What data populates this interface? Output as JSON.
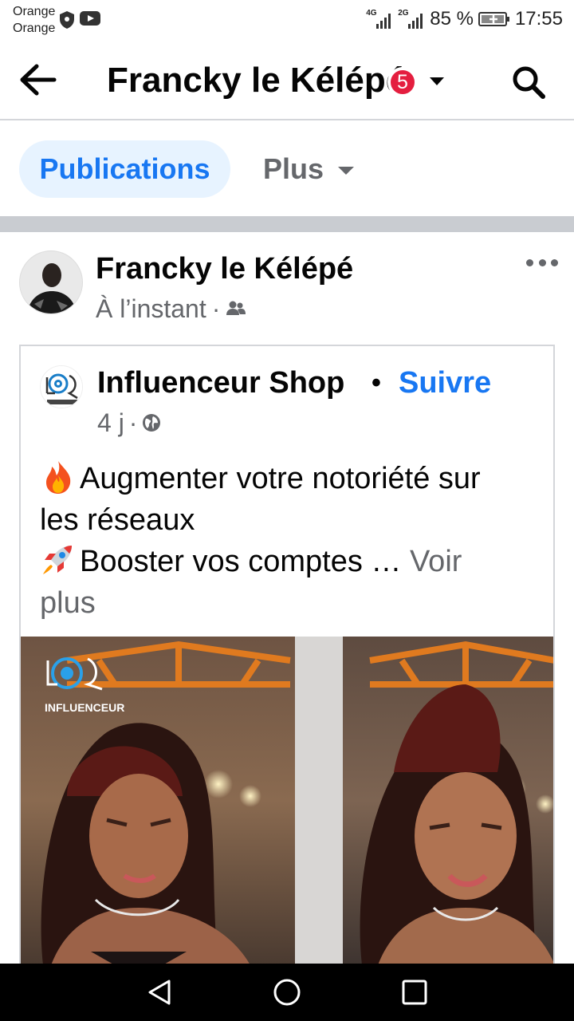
{
  "status_bar": {
    "carrier_line1": "Orange",
    "carrier_line2": "Orange",
    "signal1_tag": "4G",
    "signal2_tag": "2G",
    "battery": "85 %",
    "time": "17:55"
  },
  "header": {
    "title": "Francky le Kélépé",
    "badge_count": "5"
  },
  "tabs": {
    "publications": "Publications",
    "plus": "Plus"
  },
  "post": {
    "author": "Francky le Kélépé",
    "time": "À l’instant",
    "shared": {
      "page_name": "Influenceur Shop",
      "separator": "•",
      "follow_label": "Suivre",
      "time": "4 j",
      "text_line1": "Augmenter votre notoriété sur",
      "text_line2": "les réseaux",
      "text_line3": "Booster vos comptes … ",
      "see_more_1": "Voir",
      "see_more_2": "plus",
      "media_watermark": "INFLUENCEUR"
    }
  },
  "colors": {
    "accent": "#1877f2",
    "badge": "#e41e3f",
    "muted": "#65676b",
    "separator": "#c9ccd1"
  },
  "icons": {
    "back": "arrow-left-icon",
    "search": "search-icon",
    "caret": "chevron-down-icon",
    "more": "more-horizontal-icon",
    "audience_friends": "friends-icon",
    "audience_public": "globe-icon"
  }
}
